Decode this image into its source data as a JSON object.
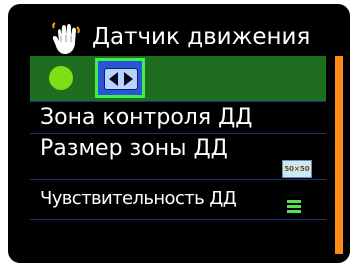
{
  "header": {
    "title": "Датчик движения",
    "icon": "hand-motion-icon"
  },
  "menu": {
    "items": [
      {
        "label": "",
        "state_icon": "green-dot-icon",
        "control_icon": "left-right-arrows-icon",
        "selected": true
      },
      {
        "label": "Зона контроля ДД"
      },
      {
        "label": "Размер зоны ДД",
        "value_badge": "50×50"
      },
      {
        "label": "Чувствительность ДД",
        "value_icon": "sensitivity-bars-icon"
      },
      {
        "label": ""
      }
    ]
  },
  "colors": {
    "background": "#000000",
    "selected_row": "#1f6e1f",
    "accent_green": "#7ddf14",
    "scrollbar": "#ff8a1a",
    "divider": "#1e2f7a"
  }
}
